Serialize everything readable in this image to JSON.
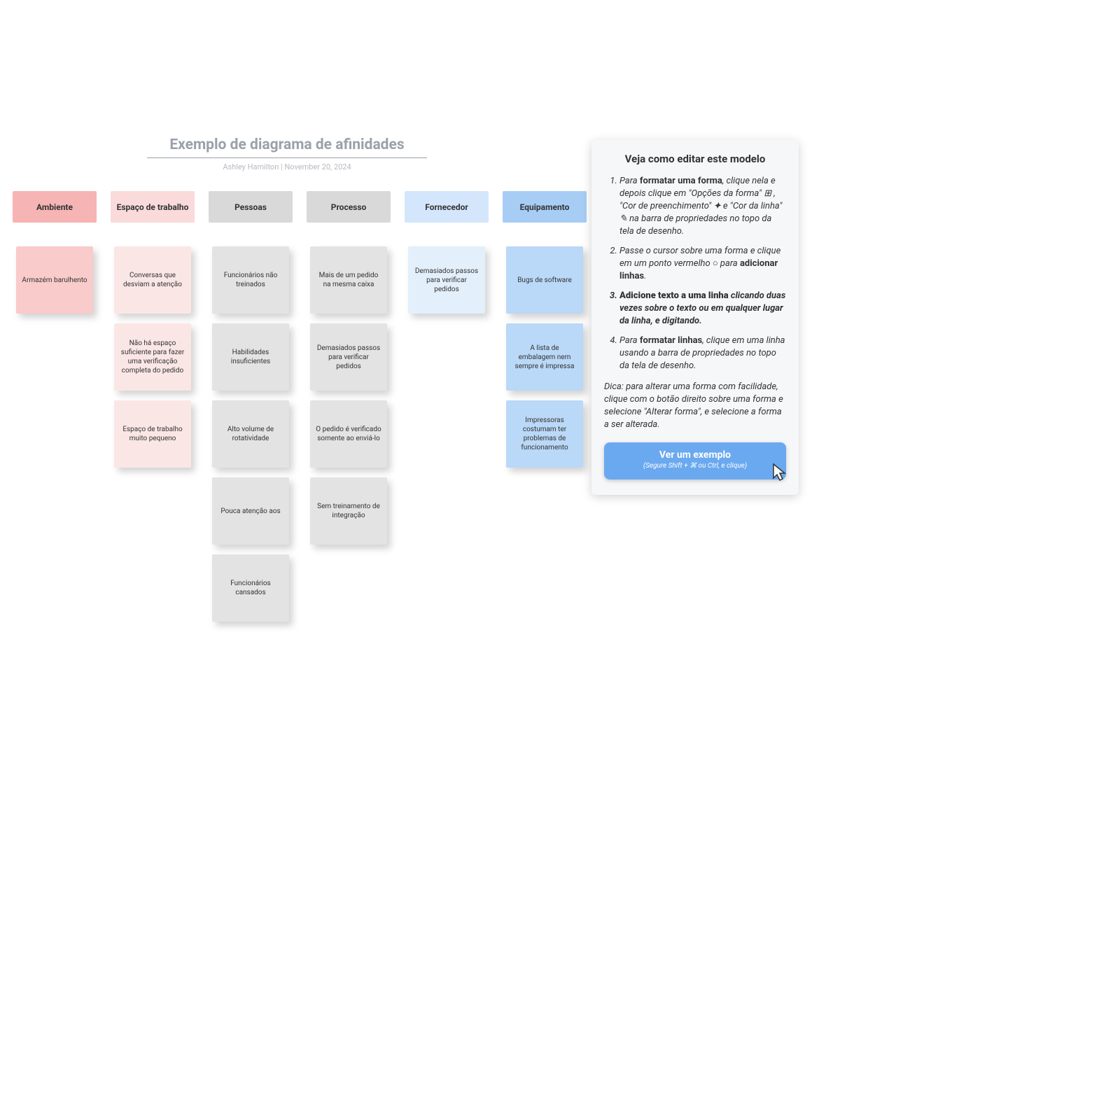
{
  "diagram": {
    "title": "Exemplo de diagrama de afinidades",
    "author": "Ashley Hamilton",
    "separator": "  |  ",
    "date": "November 20, 2024",
    "columns": [
      {
        "name": "Ambiente",
        "cards": [
          "Armazém barulhento"
        ]
      },
      {
        "name": "Espaço de trabalho",
        "cards": [
          "Conversas que desviam a atenção",
          "Não há espaço suficiente para fazer uma verificação completa do pedido",
          "Espaço de trabalho muito pequeno"
        ]
      },
      {
        "name": "Pessoas",
        "cards": [
          "Funcionários não treinados",
          "Habilidades insuficientes",
          "Alto volume de rotatividade",
          "Pouca atenção aos",
          "Funcionários cansados"
        ]
      },
      {
        "name": "Processo",
        "cards": [
          "Mais de um pedido na mesma caixa",
          "Demasiados passos para verificar pedidos",
          "O pedido é verificado somente ao enviá-lo",
          "Sem treinamento de integração"
        ]
      },
      {
        "name": "Fornecedor",
        "cards": [
          "Demasiados passos para verificar pedidos"
        ]
      },
      {
        "name": "Equipamento",
        "cards": [
          "Bugs de software",
          "A lista de embalagem nem sempre é impressa",
          "Impressoras costumam ter problemas de funcionamento"
        ]
      }
    ]
  },
  "help": {
    "title": "Veja como editar este modelo",
    "steps": [
      {
        "pre": "Para ",
        "bold": "formatar uma forma",
        "post": ", clique nela e depois clique em \"Opções da forma\" ⊞ , \"Cor de preenchimento\" 🟆  e \"Cor da linha\" ✎ na barra de propriedades no topo da tela de desenho."
      },
      {
        "pre": "Passe o cursor sobre uma forma e clique em um ponto vermelho ○ para ",
        "bold": "adicionar linhas",
        "post": "."
      },
      {
        "pre": "",
        "bold": "Adicione texto a uma linha",
        "post": " clicando duas vezes sobre o texto ou em qualquer lugar da linha, e digitando."
      },
      {
        "pre": "Para ",
        "bold": "formatar linhas",
        "post": ", clique em uma linha usando a barra de propriedades no topo da tela de desenho."
      }
    ],
    "tip": "Dica: para alterar uma forma com facilidade, clique com o botão direito sobre uma forma e selecione \"Alterar forma\", e selecione a forma a ser alterada.",
    "button_main": "Ver um exemplo",
    "button_sub": "(Segure Shift + ⌘ ou Ctrl, e clique)"
  }
}
